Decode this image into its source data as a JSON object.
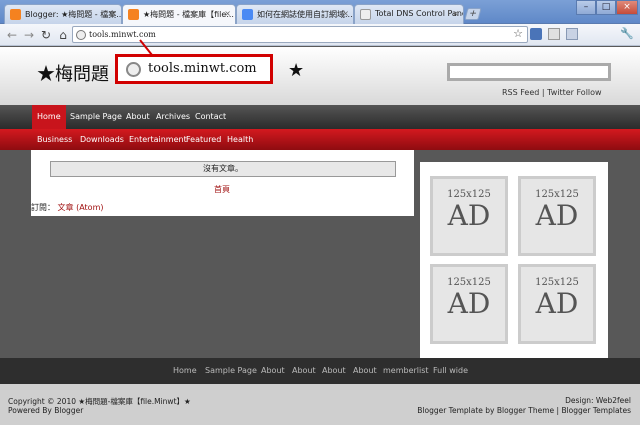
{
  "browser": {
    "tabs": [
      {
        "label": "Blogger: ★梅問題 - 檔案...",
        "fav_color": "#f58220"
      },
      {
        "label": "★梅問題 - 檔案庫【file...",
        "fav_color": "#f58220"
      },
      {
        "label": "如何在網誌使用自訂網域...",
        "fav_color": "#4a8af4"
      },
      {
        "label": "Total DNS Control Panel",
        "fav_color": "#eeeeee"
      }
    ],
    "tab_close": "×",
    "new_tab": "+",
    "window_buttons": [
      "–",
      "□",
      "×"
    ],
    "url": "tools.minwt.com",
    "nav": {
      "back": "←",
      "forward": "→",
      "reload": "↻",
      "home": "⌂"
    },
    "toolbar_icons": {
      "star": "☆",
      "wrench": "🔧"
    }
  },
  "callout": {
    "url": "tools.minwt.com",
    "color": "#d10000"
  },
  "site": {
    "title": "★梅問題",
    "title_star": "★",
    "header_links": "RSS Feed | Twitter Follow",
    "nav_primary": [
      "Home",
      "Sample Page",
      "About",
      "Archives",
      "Contact"
    ],
    "nav_secondary": [
      "Business",
      "Downloads",
      "Entertainment",
      "Featured",
      "Health"
    ],
    "no_posts": "沒有文章。",
    "home_link": "首頁",
    "subscribe_label": "訂閱：",
    "subscribe_link": "文章 (Atom)",
    "ad": {
      "size": "125x125",
      "text": "AD"
    },
    "footer_nav": [
      "Home",
      "Sample Page",
      "About",
      "About",
      "About",
      "About",
      "memberlist",
      "Full wide"
    ],
    "footer_left_1": "Copyright © 2010 ★梅問題-檔案庫【file.Minwt】★",
    "footer_left_2": "Powered By Blogger",
    "footer_right_1": "Design: Web2feel",
    "footer_right_2": "Blogger Template by Blogger Theme | Blogger Templates",
    "accent": "#c8141c"
  }
}
